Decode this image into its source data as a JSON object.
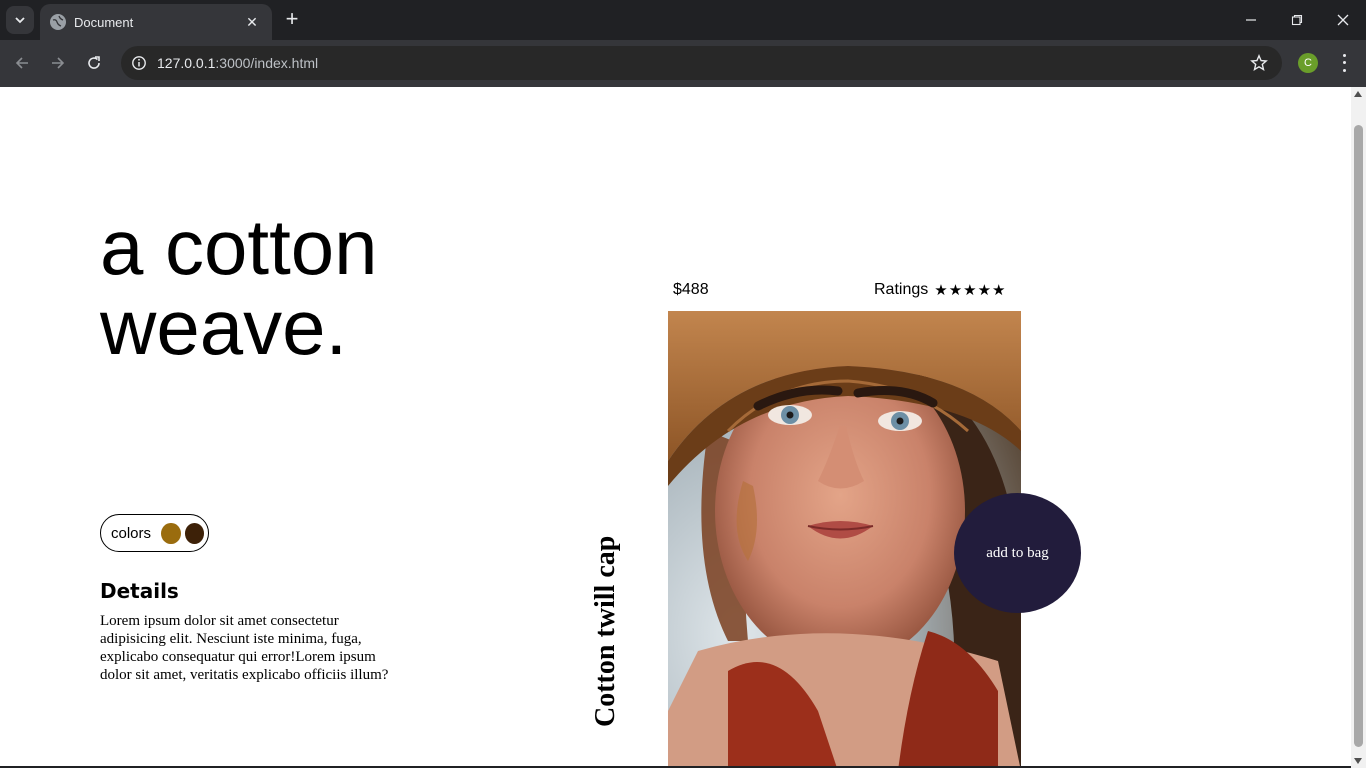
{
  "browser": {
    "tab_title": "Document",
    "url_host": "127.0.0.1",
    "url_path": ":3000/index.html",
    "profile_initial": "C"
  },
  "page": {
    "hero": {
      "line1": "a cotton",
      "line2": "weave."
    },
    "colors": {
      "label": "colors",
      "swatches": [
        "#9a6c0e",
        "#3d2108"
      ]
    },
    "details": {
      "heading": "Details",
      "text": "Lorem ipsum dolor sit amet consectetur adipisicing elit. Nesciunt iste minima, fuga, explicabo consequatur qui error!Lorem ipsum dolor sit amet, veritatis explicabo officiis illum?"
    },
    "product": {
      "price": "$488",
      "ratings_label": "Ratings",
      "stars": "★★★★★",
      "rating_value": 5,
      "name": "Cotton twill cap",
      "add_to_bag": "add to bag",
      "accent_color": "#221c3c"
    }
  }
}
